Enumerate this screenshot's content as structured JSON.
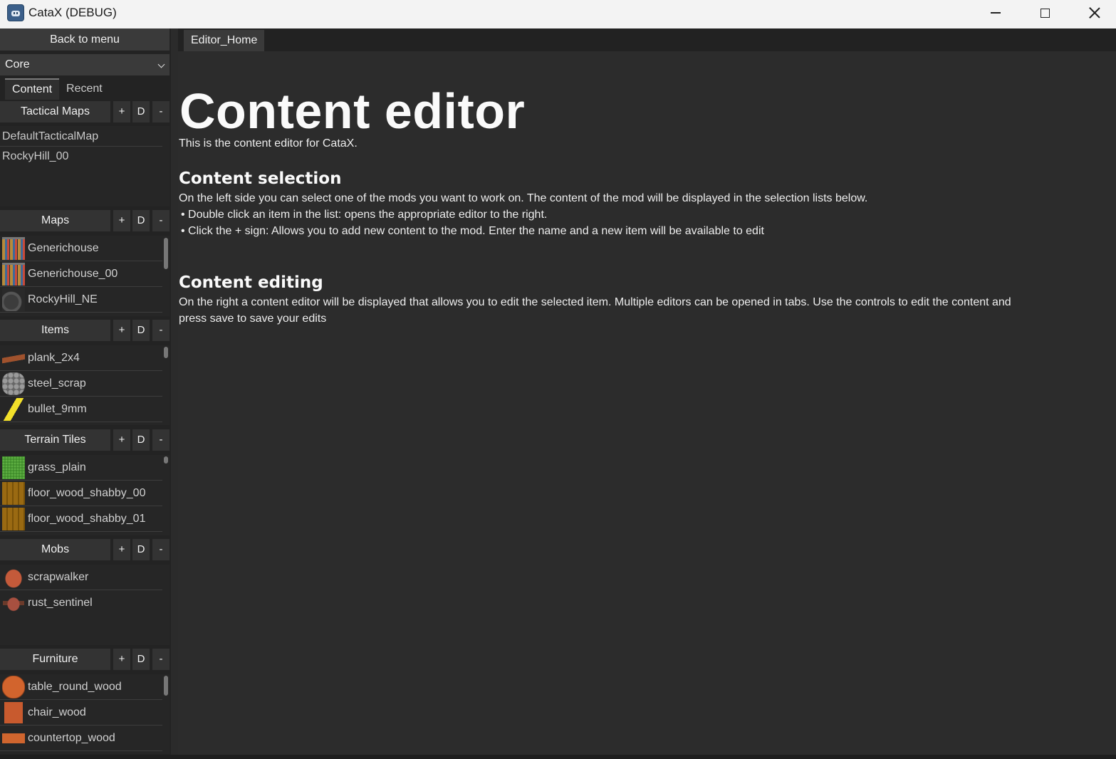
{
  "window": {
    "title": "CataX (DEBUG)"
  },
  "sidebar": {
    "back_label": "Back to menu",
    "mod_selected": "Core",
    "tabs": [
      "Content",
      "Recent"
    ],
    "header_buttons": {
      "add": "+",
      "duplicate": "D",
      "remove": "-"
    },
    "sections": [
      {
        "title": "Tactical Maps",
        "items": [
          "DefaultTacticalMap",
          "RockyHill_00"
        ]
      },
      {
        "title": "Maps",
        "items": [
          "Generichouse",
          "Generichouse_00",
          "RockyHill_NE"
        ]
      },
      {
        "title": "Items",
        "items": [
          "plank_2x4",
          "steel_scrap",
          "bullet_9mm"
        ]
      },
      {
        "title": "Terrain Tiles",
        "items": [
          "grass_plain",
          "floor_wood_shabby_00",
          "floor_wood_shabby_01"
        ]
      },
      {
        "title": "Mobs",
        "items": [
          "scrapwalker",
          "rust_sentinel"
        ]
      },
      {
        "title": "Furniture",
        "items": [
          "table_round_wood",
          "chair_wood",
          "countertop_wood"
        ]
      }
    ]
  },
  "main": {
    "tab_label": "Editor_Home",
    "heading": "Content editor",
    "intro": "This is the content editor for CataX.",
    "selection_title": "Content selection",
    "selection_text": "On the left side you can select one of the mods you want to work on. The content of the mod will be displayed in the selection lists below.",
    "selection_bullets": [
      "• Double click an item in the list: opens the appropriate editor to the right.",
      "• Click the + sign: Allows you to add new content to the mod. Enter the name and a new item will be available to edit"
    ],
    "editing_title": "Content editing",
    "editing_text_1": "On the right a content editor will be displayed that allows you to edit the selected item. Multiple editors can be opened in tabs. Use the controls to edit the content and",
    "editing_text_2": "press save to save your edits"
  }
}
